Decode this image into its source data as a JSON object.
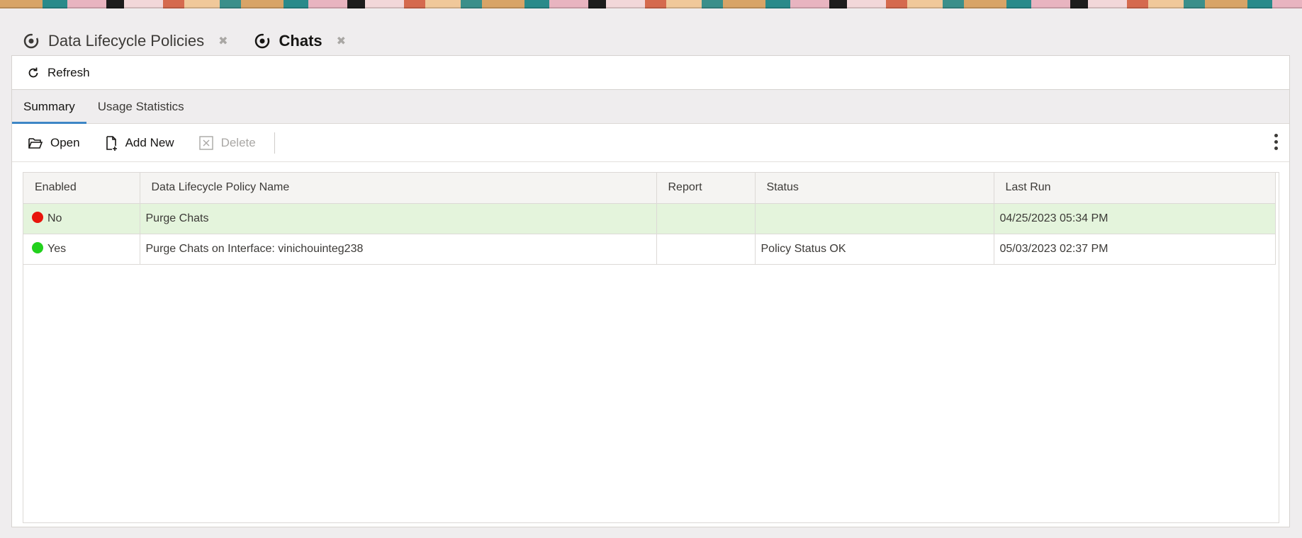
{
  "doc_tabs": [
    {
      "label": "Data Lifecycle Policies",
      "active": false
    },
    {
      "label": "Chats",
      "active": true
    }
  ],
  "toolbar": {
    "refresh_label": "Refresh"
  },
  "sub_tabs": [
    {
      "label": "Summary",
      "active": true
    },
    {
      "label": "Usage Statistics",
      "active": false
    }
  ],
  "actions": {
    "open_label": "Open",
    "add_new_label": "Add New",
    "delete_label": "Delete"
  },
  "table": {
    "columns": [
      "Enabled",
      "Data Lifecycle Policy Name",
      "Report",
      "Status",
      "Last Run"
    ],
    "rows": [
      {
        "enabled": "No",
        "status_color": "#e8140c",
        "name": "Purge Chats",
        "report": "",
        "status": "",
        "last_run": "04/25/2023 05:34 PM",
        "selected": true
      },
      {
        "enabled": "Yes",
        "status_color": "#22d11d",
        "name": "Purge Chats on Interface: vinichouinteg238",
        "report": "",
        "status": "Policy Status OK",
        "last_run": "05/03/2023 02:37 PM",
        "selected": false
      }
    ]
  },
  "colors": {
    "accent": "#3d86c6",
    "selected_row": "#e4f4dc"
  }
}
